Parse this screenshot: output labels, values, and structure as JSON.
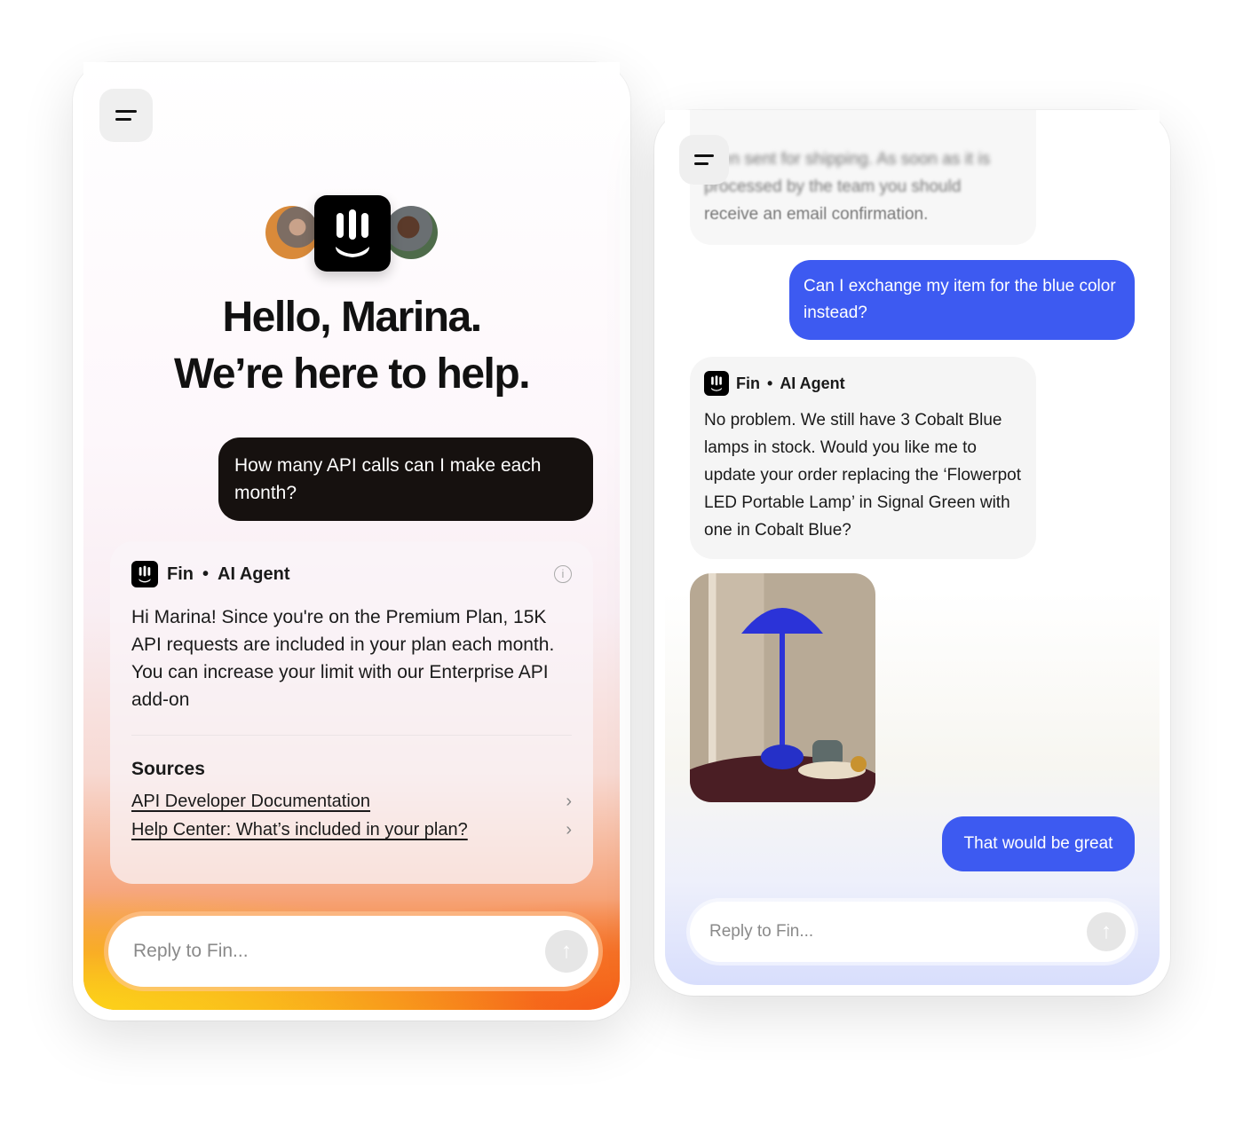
{
  "left": {
    "heading_line1": "Hello, Marina.",
    "heading_line2": "We’re here to help.",
    "user_message": "How many API calls can I make each month?",
    "agent": {
      "name": "Fin",
      "separator": "•",
      "role": "AI Agent",
      "message": "Hi Marina! Since you're on the Premium Plan, 15K API requests are included in your plan each month. You can increase your limit with our Enterprise API add-on"
    },
    "sources_title": "Sources",
    "sources": [
      {
        "label": "API Developer Documentation"
      },
      {
        "label": "Help Center: What’s included in your plan?"
      }
    ],
    "input_placeholder": "Reply to Fin...",
    "send_icon": "arrow-up-icon"
  },
  "right": {
    "blurred_lines": [
      "…en sent for shipping. As soon as it is",
      "processed by the team you should",
      "receive an email confirmation."
    ],
    "user_message_1": "Can I exchange my item for the blue color instead?",
    "agent": {
      "name": "Fin",
      "separator": "•",
      "role": "AI Agent",
      "message": "No problem. We still have 3 Cobalt Blue lamps in stock. Would you like me to  update your order replacing the ‘Flowerpot LED Portable Lamp’ in Signal Green with one in Cobalt Blue?"
    },
    "user_message_2": "That would be great",
    "input_placeholder": "Reply to Fin...",
    "accent": "#3d5af1"
  }
}
